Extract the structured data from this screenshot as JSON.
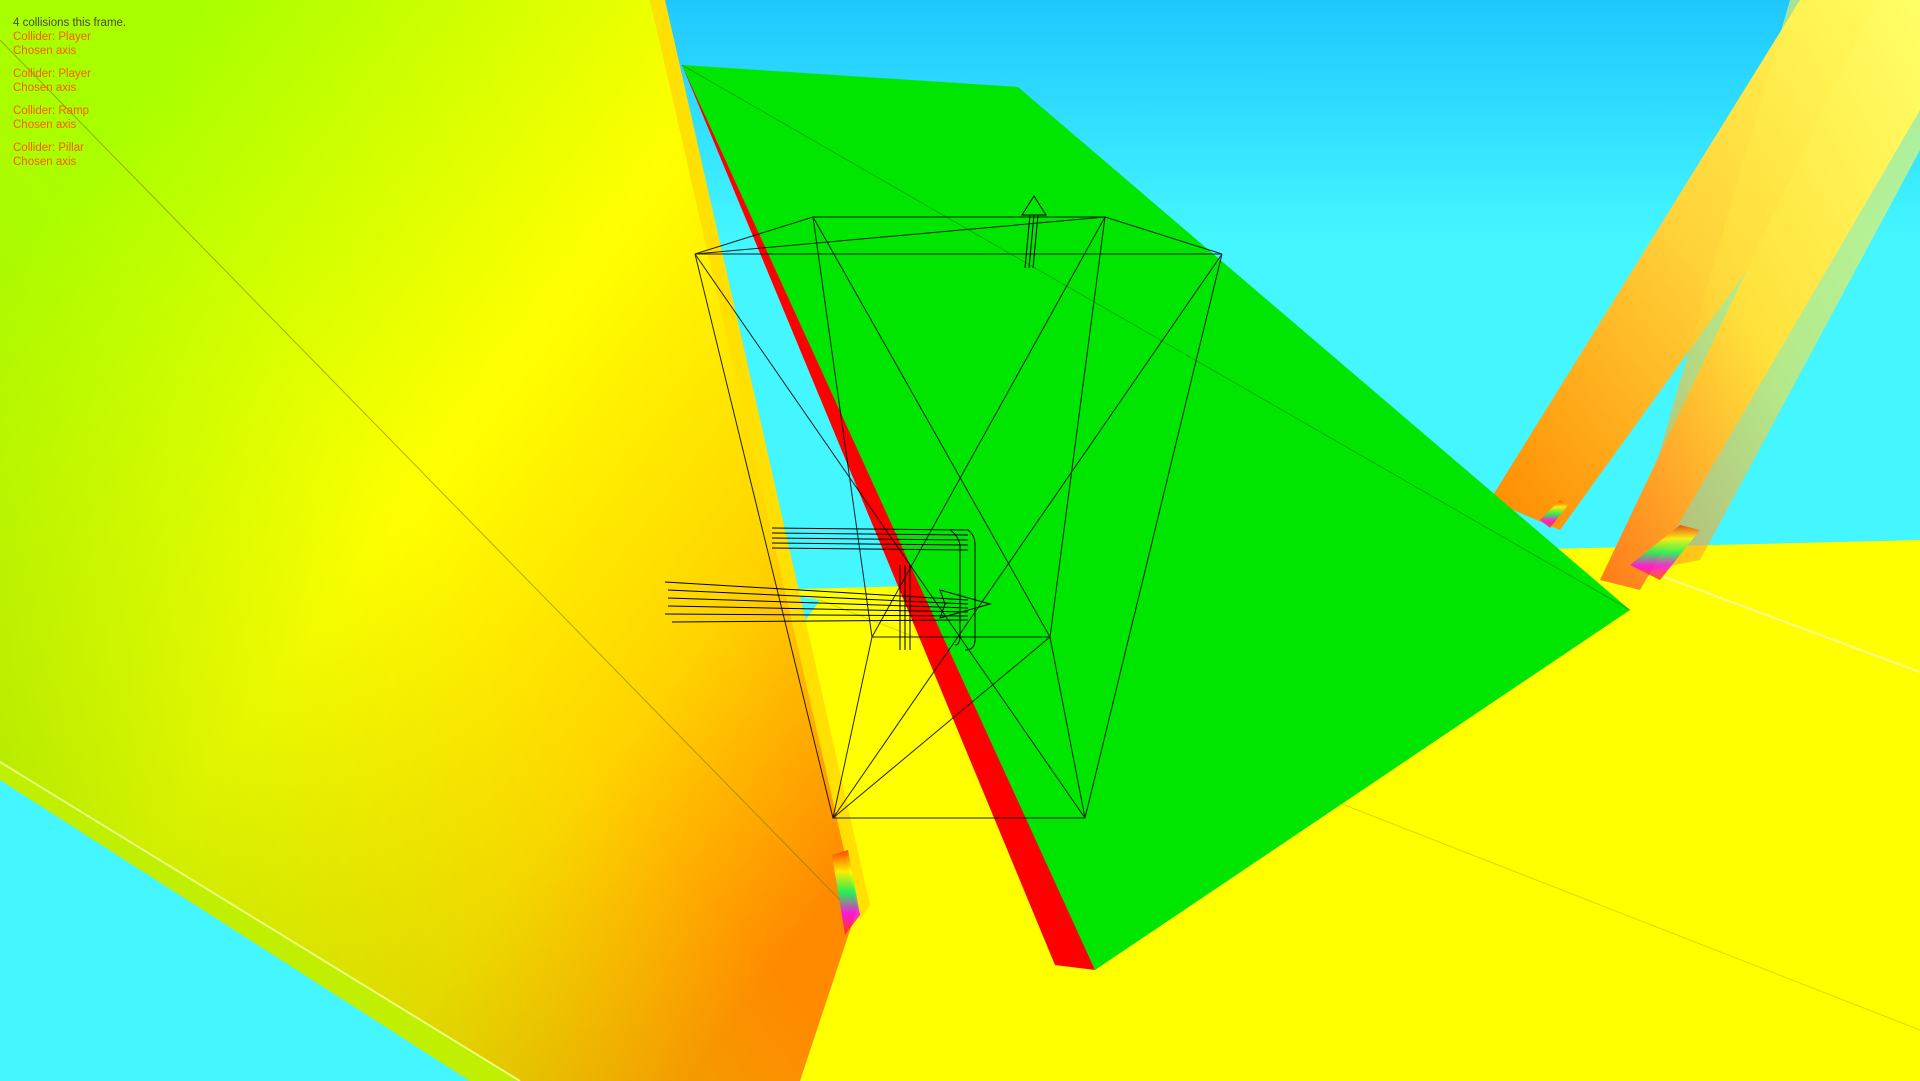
{
  "hud": {
    "collision_count_text": "4 collisions this frame.",
    "collisions": [
      {
        "collider_text": "Collider: Player",
        "axis_text": "Chosen axis"
      },
      {
        "collider_text": "Collider: Player",
        "axis_text": "Chosen axis"
      },
      {
        "collider_text": "Collider: Ramp",
        "axis_text": "Chosen axis"
      },
      {
        "collider_text": "Collider: Pillar",
        "axis_text": "Chosen axis"
      }
    ]
  },
  "colors": {
    "sky_top": "#1ec8ff",
    "sky_bottom": "#44f6ff",
    "ground": "#ffff00",
    "ramp_top": "#00e600",
    "ramp_side": "#ff0000",
    "pillar_light": "#ffff2a",
    "pillar_orange": "#ff8a00",
    "wall_green": "#9de000",
    "wireframe": "#000000",
    "hud_text": "#ff5a00",
    "hud_headline": "#4a4a3a"
  }
}
